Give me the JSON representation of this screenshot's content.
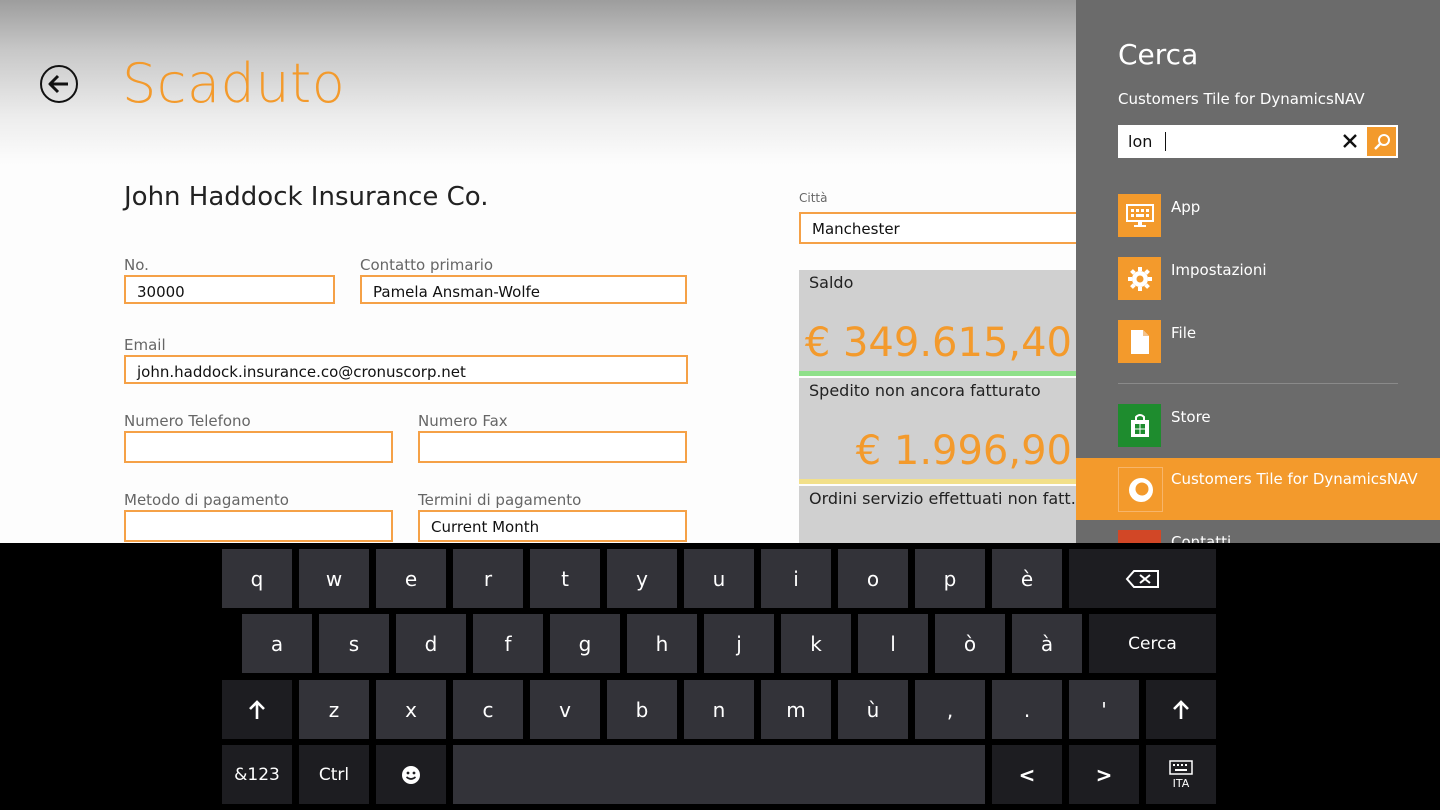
{
  "app": {
    "title": "Scaduto",
    "customer_name": "John Haddock Insurance Co.",
    "fields": {
      "no_label": "No.",
      "no_value": "30000",
      "contact_label": "Contatto primario",
      "contact_value": "Pamela Ansman-Wolfe",
      "email_label": "Email",
      "email_value": "john.haddock.insurance.co@cronuscorp.net",
      "phone_label": "Numero Telefono",
      "phone_value": "",
      "fax_label": "Numero Fax",
      "fax_value": "",
      "payment_method_label": "Metodo di pagamento",
      "payment_method_value": "",
      "payment_terms_label": "Termini di pagamento",
      "payment_terms_value": "Current Month",
      "city_label": "Città",
      "city_value": "Manchester"
    },
    "tiles": [
      {
        "title": "Saldo",
        "value": "€ 349.615,40",
        "bar_color": "#8fe08a"
      },
      {
        "title": "Spedito non ancora fatturato",
        "value": "€ 1.996,90",
        "bar_color": "#f2e08a"
      },
      {
        "title": "Ordini servizio effettuati non fatt.",
        "value": "",
        "bar_color": ""
      }
    ],
    "accent_color": "#f39a2c"
  },
  "search_panel": {
    "title": "Cerca",
    "scope": "Customers Tile for DynamicsNAV",
    "query": "lon",
    "items": [
      {
        "label": "App",
        "icon": "keyboard-monitor-icon",
        "color": "#f39a2c"
      },
      {
        "label": "Impostazioni",
        "icon": "gear-icon",
        "color": "#f39a2c"
      },
      {
        "label": "File",
        "icon": "document-icon",
        "color": "#f39a2c"
      },
      {
        "label": "Store",
        "icon": "store-icon",
        "color": "#1e8c2e"
      },
      {
        "label": "Customers Tile for DynamicsNAV",
        "icon": "app-ring-icon",
        "color": "#f39a2c"
      },
      {
        "label": "Contatti",
        "icon": "contacts-icon",
        "color": "#d24726"
      }
    ]
  },
  "keyboard": {
    "row1": [
      "q",
      "w",
      "e",
      "r",
      "t",
      "y",
      "u",
      "i",
      "o",
      "p",
      "è"
    ],
    "row2": [
      "a",
      "s",
      "d",
      "f",
      "g",
      "h",
      "j",
      "k",
      "l",
      "ò",
      "à"
    ],
    "row3": [
      "z",
      "x",
      "c",
      "v",
      "b",
      "n",
      "m",
      "ù",
      ",",
      ".",
      "'"
    ],
    "search_key": "Cerca",
    "num_key": "&123",
    "ctrl_key": "Ctrl",
    "lang_key": "ITA",
    "left_key": "<",
    "right_key": ">"
  }
}
